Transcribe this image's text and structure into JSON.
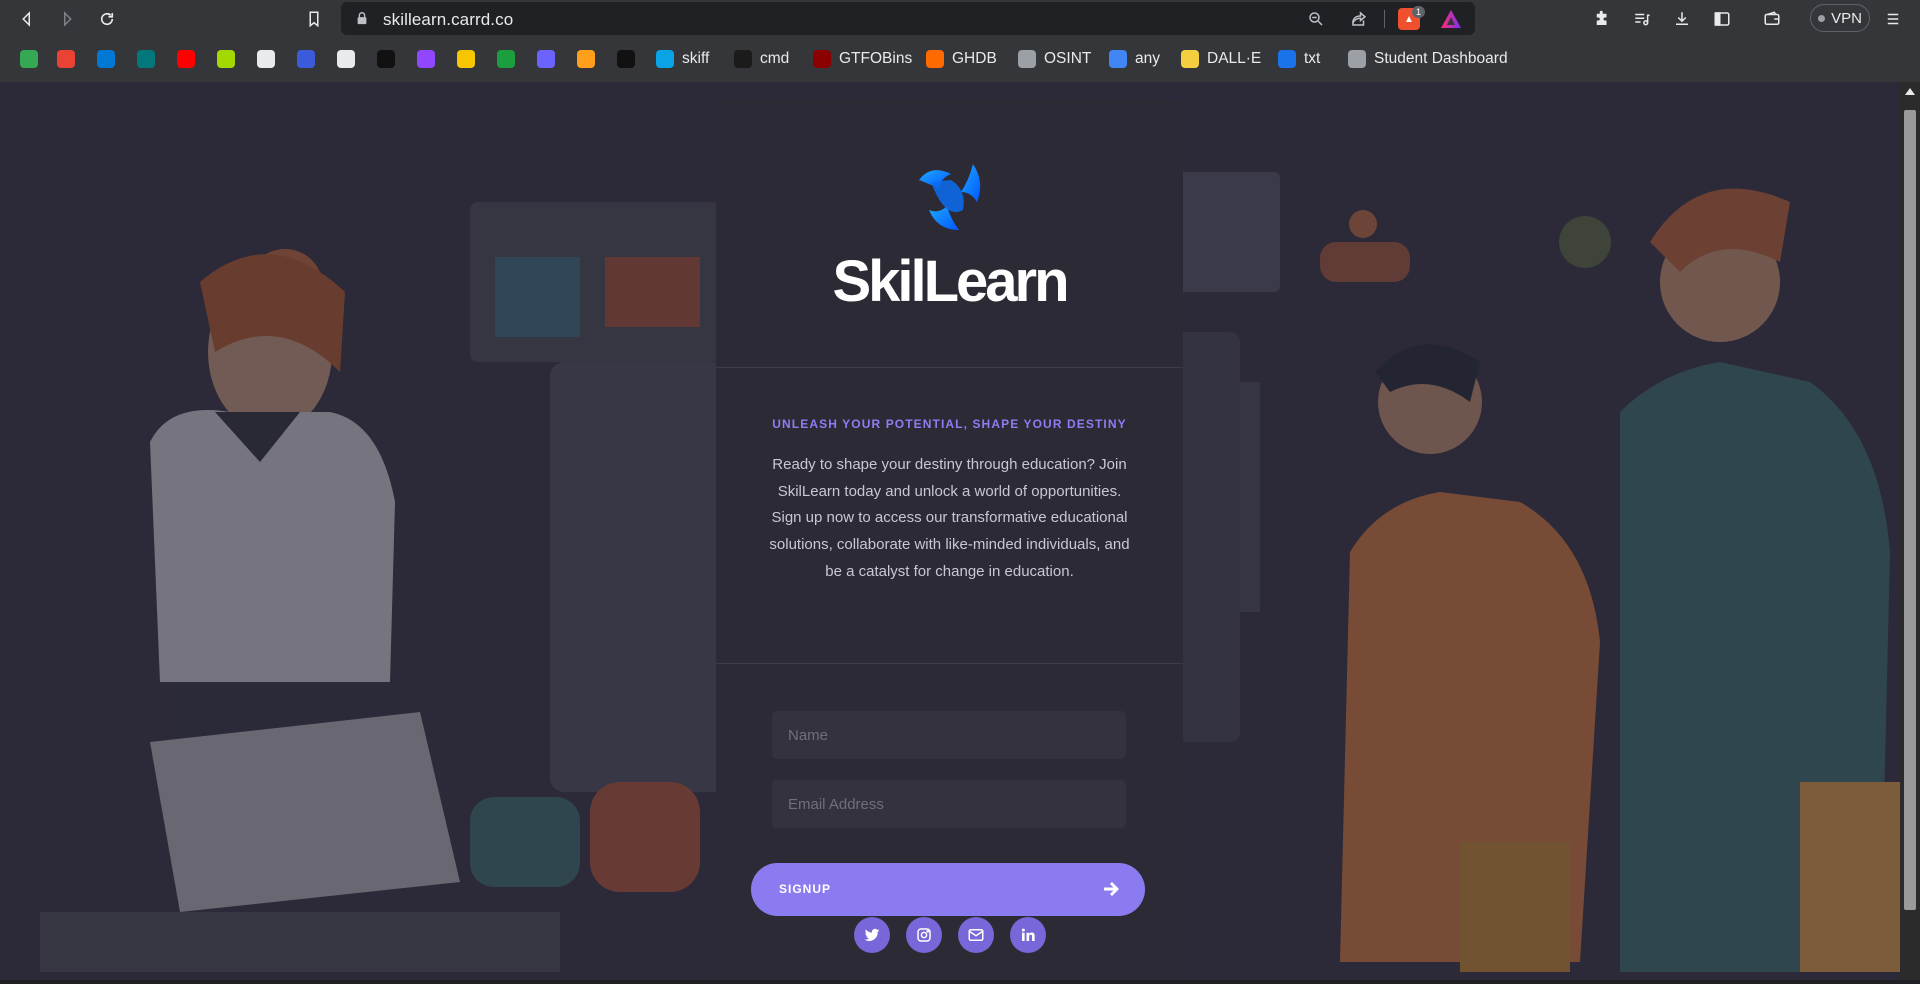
{
  "browser": {
    "url": "skillearn.carrd.co",
    "brave_badge_count": "1",
    "vpn_label": "VPN"
  },
  "bookmarks": [
    {
      "icon": "maps-icon",
      "label": "",
      "color": "#34a853"
    },
    {
      "icon": "gmail-icon",
      "label": "",
      "color": "#ea4335"
    },
    {
      "icon": "outlook-icon",
      "label": "",
      "color": "#0078d4"
    },
    {
      "icon": "sharepoint-icon",
      "label": "",
      "color": "#03787c"
    },
    {
      "icon": "youtube-icon",
      "label": "",
      "color": "#ff0000"
    },
    {
      "icon": "cube-icon",
      "label": "",
      "color": "#a3d900"
    },
    {
      "icon": "openai-icon",
      "label": "",
      "color": "#e8eaed"
    },
    {
      "icon": "hackerrank-icon",
      "label": "",
      "color": "#3b5bdb"
    },
    {
      "icon": "github-icon",
      "label": "",
      "color": "#e8eaed"
    },
    {
      "icon": "ghost-icon",
      "label": "",
      "color": "#111111"
    },
    {
      "icon": "twitch-icon",
      "label": "",
      "color": "#9146ff"
    },
    {
      "icon": "info-icon",
      "label": "",
      "color": "#f7c600"
    },
    {
      "icon": "w-icon",
      "label": "",
      "color": "#1b9e3e"
    },
    {
      "icon": "robot-icon",
      "label": "",
      "color": "#6c63ff"
    },
    {
      "icon": "gradient-icon",
      "label": "",
      "color": "#ff9f1c"
    },
    {
      "icon": "s-icon",
      "label": "",
      "color": "#111111"
    },
    {
      "icon": "skiff-icon",
      "label": "skiff",
      "color": "#0aa3e5"
    },
    {
      "icon": "cmd-icon",
      "label": "cmd",
      "color": "#1b1b1b"
    },
    {
      "icon": "gtfobins-icon",
      "label": "GTFOBins",
      "color": "#8b0000"
    },
    {
      "icon": "ghdb-icon",
      "label": "GHDB",
      "color": "#ff6a00"
    },
    {
      "icon": "globe-icon",
      "label": "OSINT",
      "color": "#9aa0a6"
    },
    {
      "icon": "any-icon",
      "label": "any",
      "color": "#4285f4"
    },
    {
      "icon": "dalle-icon",
      "label": "DALL·E",
      "color": "#f4d03f"
    },
    {
      "icon": "txt-icon",
      "label": "txt",
      "color": "#1a73e8"
    },
    {
      "icon": "globe-icon",
      "label": "Student Dashboard",
      "color": "#9aa0a6"
    }
  ],
  "page": {
    "brand": "SkilLearn",
    "tagline": "UNLEASH YOUR POTENTIAL, SHAPE YOUR DESTINY",
    "intro": "Ready to shape your destiny through education? Join SkilLearn today and unlock a world of opportunities. Sign up now to access our transformative educational solutions, collaborate with like-minded individuals, and be a catalyst for change in education.",
    "name_placeholder": "Name",
    "email_placeholder": "Email Address",
    "signup_label": "SIGNUP",
    "social": [
      "twitter-icon",
      "instagram-icon",
      "email-icon",
      "linkedin-icon"
    ],
    "accent_color": "#8b7bf0"
  }
}
